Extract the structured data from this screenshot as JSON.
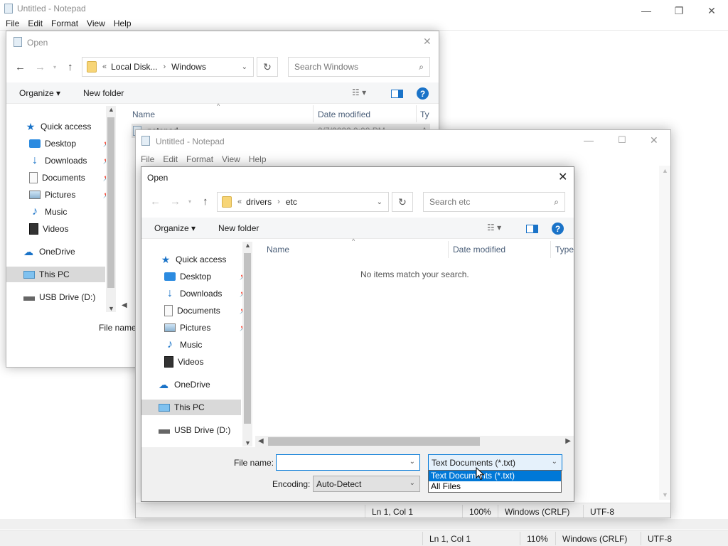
{
  "back_notepad": {
    "title": "Untitled - Notepad",
    "menu": [
      "File",
      "Edit",
      "Format",
      "View",
      "Help"
    ],
    "status": {
      "position": "Ln 1, Col 1",
      "zoom": "110%",
      "line_ending": "Windows (CRLF)",
      "encoding": "UTF-8"
    }
  },
  "back_dialog": {
    "title": "Open",
    "breadcrumb": [
      "Local Disk...",
      "Windows"
    ],
    "search_placeholder": "Search Windows",
    "organize": "Organize",
    "new_folder": "New folder",
    "columns": {
      "name": "Name",
      "date": "Date modified",
      "type": "Ty"
    },
    "file_row": {
      "name": "notepad",
      "date": "9/7/2022 9:08 PM",
      "type": "A"
    },
    "file_name_label": "File name"
  },
  "front_notepad": {
    "title": "Untitled - Notepad",
    "menu": [
      "File",
      "Edit",
      "Format",
      "View",
      "Help"
    ],
    "status": {
      "position": "Ln 1, Col 1",
      "zoom": "100%",
      "line_ending": "Windows (CRLF)",
      "encoding": "UTF-8"
    }
  },
  "front_dialog": {
    "title": "Open",
    "breadcrumb": [
      "drivers",
      "etc"
    ],
    "search_placeholder": "Search etc",
    "organize": "Organize",
    "new_folder": "New folder",
    "columns": {
      "name": "Name",
      "date": "Date modified",
      "type": "Type"
    },
    "empty_message": "No items match your search.",
    "file_name_label": "File name:",
    "file_name_value": "",
    "encoding_label": "Encoding:",
    "encoding_value": "Auto-Detect",
    "file_type_value": "Text Documents (*.txt)",
    "file_type_options": [
      "Text Documents (*.txt)",
      "All Files"
    ]
  },
  "nav_pane": {
    "quick_access": "Quick access",
    "items": [
      "Desktop",
      "Downloads",
      "Documents",
      "Pictures",
      "Music",
      "Videos"
    ],
    "onedrive": "OneDrive",
    "this_pc": "This PC",
    "usb": "USB Drive (D:)"
  },
  "colors": {
    "accent": "#0078d7",
    "selection": "#0078d7",
    "nav_selected": "#d9d9d9"
  }
}
